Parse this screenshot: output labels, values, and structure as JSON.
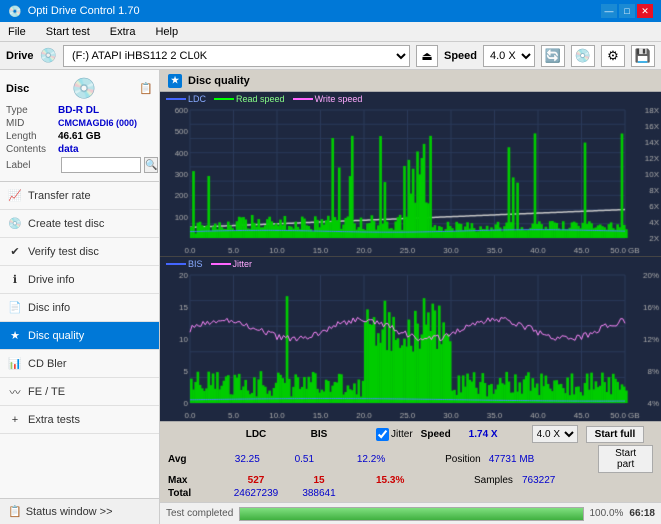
{
  "window": {
    "title": "Opti Drive Control 1.70",
    "controls": [
      "—",
      "□",
      "✕"
    ]
  },
  "menu": {
    "items": [
      "File",
      "Start test",
      "Extra",
      "Help"
    ]
  },
  "drive_bar": {
    "label": "Drive",
    "drive_value": "(F:) ATAPI iHBS112  2 CL0K",
    "speed_label": "Speed",
    "speed_value": "4.0 X"
  },
  "disc": {
    "header": "Disc",
    "type_label": "Type",
    "type_value": "BD-R DL",
    "mid_label": "MID",
    "mid_value": "CMCMAGDI6 (000)",
    "length_label": "Length",
    "length_value": "46.61 GB",
    "contents_label": "Contents",
    "contents_value": "data",
    "label_label": "Label",
    "label_value": ""
  },
  "nav": {
    "items": [
      {
        "id": "start-test",
        "label": "Start test",
        "icon": "▶"
      },
      {
        "id": "transfer-rate",
        "label": "Transfer rate",
        "icon": "📈"
      },
      {
        "id": "create-test-disc",
        "label": "Create test disc",
        "icon": "💿"
      },
      {
        "id": "verify-test-disc",
        "label": "Verify test disc",
        "icon": "✔"
      },
      {
        "id": "drive-info",
        "label": "Drive info",
        "icon": "ℹ"
      },
      {
        "id": "disc-info",
        "label": "Disc info",
        "icon": "📄"
      },
      {
        "id": "disc-quality",
        "label": "Disc quality",
        "icon": "★",
        "active": true
      },
      {
        "id": "cd-bler",
        "label": "CD Bler",
        "icon": "📊"
      },
      {
        "id": "fe-te",
        "label": "FE / TE",
        "icon": "〰"
      },
      {
        "id": "extra-tests",
        "label": "Extra tests",
        "icon": "+"
      }
    ],
    "status_window": "Status window >>",
    "status_icon": "📋"
  },
  "disc_quality": {
    "title": "Disc quality",
    "legend_top": [
      "LDC",
      "Read speed",
      "Write speed"
    ],
    "legend_bottom": [
      "BIS",
      "Jitter"
    ],
    "axis_right_top": [
      "18X",
      "16X",
      "14X",
      "12X",
      "10X",
      "8X",
      "6X",
      "4X",
      "2X"
    ],
    "axis_right_bottom": [
      "20%",
      "16%",
      "12%",
      "8%",
      "4%"
    ],
    "axis_bottom": [
      "0.0",
      "5.0",
      "10.0",
      "15.0",
      "20.0",
      "25.0",
      "30.0",
      "35.0",
      "40.0",
      "45.0",
      "50.0 GB"
    ]
  },
  "stats": {
    "col_headers": [
      "LDC",
      "BIS",
      "",
      "Jitter",
      "Speed",
      "",
      ""
    ],
    "avg_label": "Avg",
    "avg_ldc": "32.25",
    "avg_bis": "0.51",
    "avg_jitter": "12.2%",
    "max_label": "Max",
    "max_ldc": "527",
    "max_bis": "15",
    "max_jitter": "15.3%",
    "total_label": "Total",
    "total_ldc": "24627239",
    "total_bis": "388641",
    "speed_value": "1.74 X",
    "speed_select": "4.0 X",
    "position_label": "Position",
    "position_value": "47731 MB",
    "samples_label": "Samples",
    "samples_value": "763227",
    "start_full": "Start full",
    "start_part": "Start part",
    "jitter_checked": true
  },
  "progress": {
    "status": "Test completed",
    "percent": 100,
    "time": "66:18"
  }
}
